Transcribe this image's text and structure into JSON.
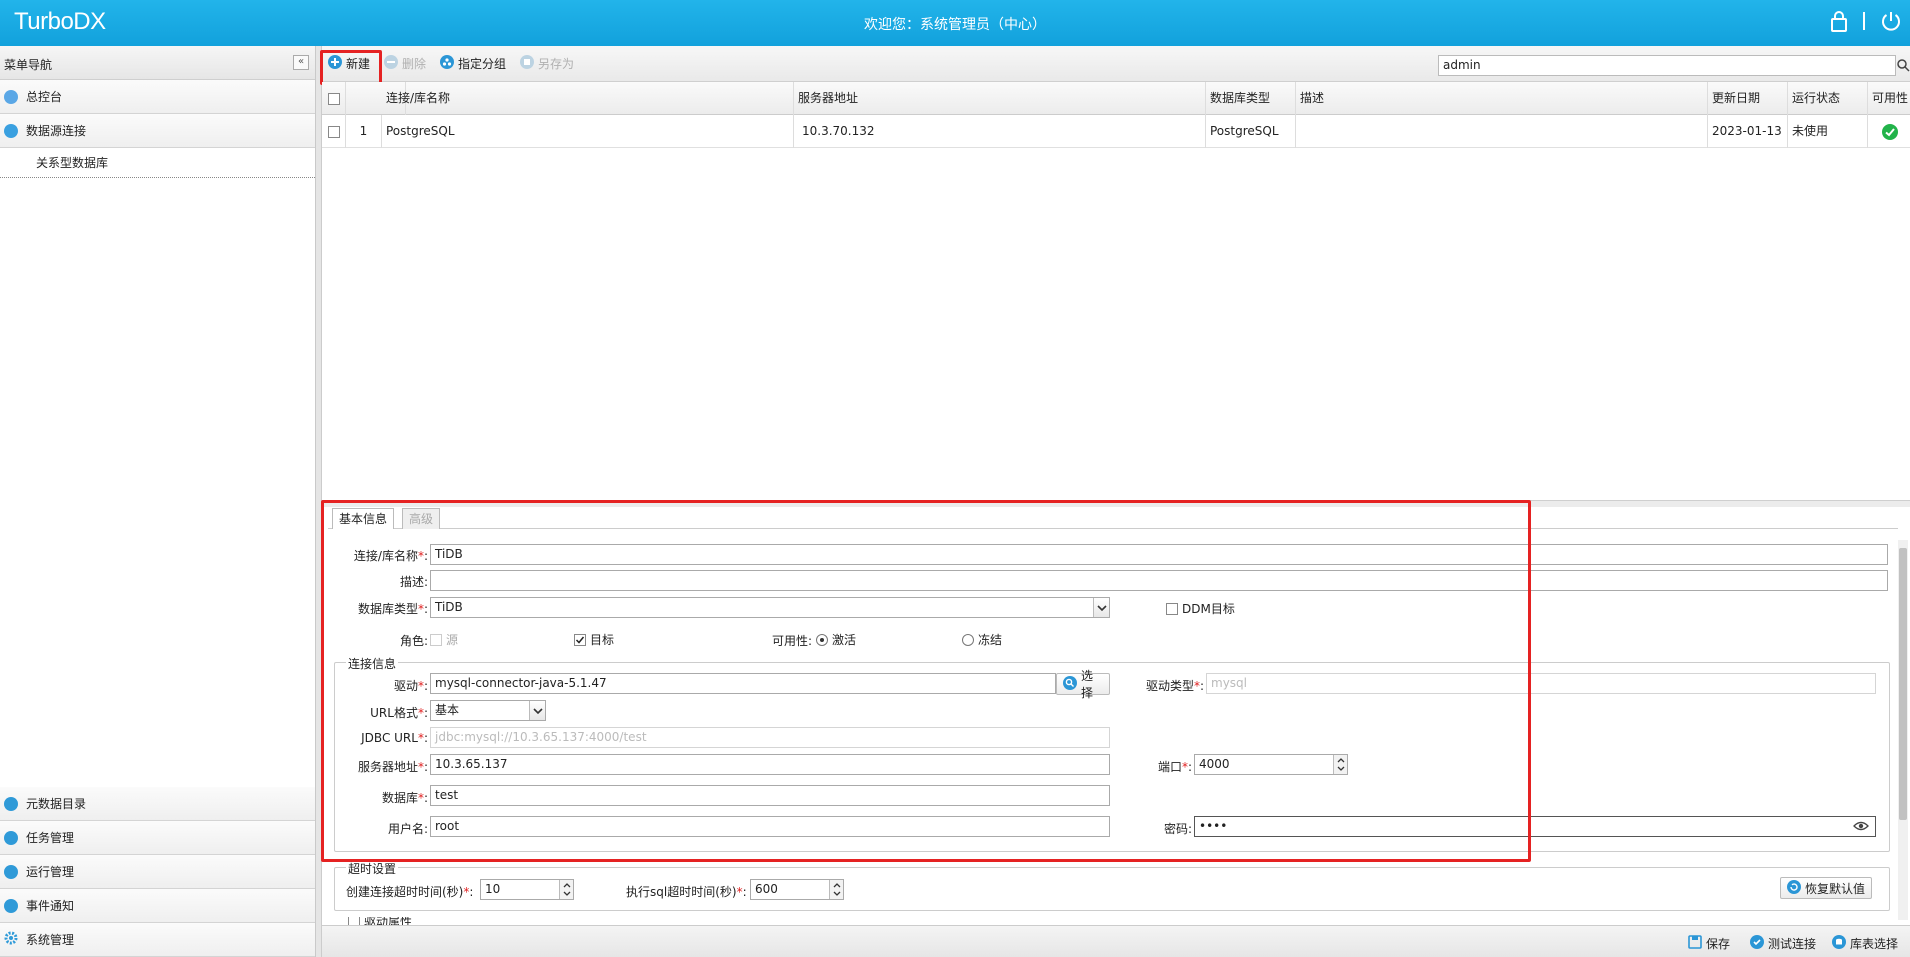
{
  "header": {
    "logo": "TurboDX",
    "welcome": "欢迎您：系统管理员（中心）"
  },
  "sidebar": {
    "title": "菜单导航",
    "items_top": [
      {
        "label": "总控台",
        "icon": "dashboard-icon"
      },
      {
        "label": "数据源连接",
        "icon": "link-icon"
      }
    ],
    "sub_item": "关系型数据库",
    "items_bottom": [
      {
        "label": "元数据目录",
        "icon": "metadata-icon"
      },
      {
        "label": "任务管理",
        "icon": "task-icon"
      },
      {
        "label": "运行管理",
        "icon": "run-icon"
      },
      {
        "label": "事件通知",
        "icon": "notification-icon"
      },
      {
        "label": "系统管理",
        "icon": "gear-icon"
      }
    ]
  },
  "toolbar": {
    "new_label": "新建",
    "delete_label": "删除",
    "assign_group_label": "指定分组",
    "save_as_label": "另存为",
    "search_value": "admin"
  },
  "grid": {
    "columns": [
      "连接/库名称",
      "服务器地址",
      "数据库类型",
      "描述",
      "更新日期",
      "运行状态",
      "可用性"
    ],
    "rows": [
      {
        "index": "1",
        "name": "PostgreSQL",
        "server": "10.3.70.132",
        "db_type": "PostgreSQL",
        "desc": "",
        "updated": "2023-01-13",
        "status": "未使用",
        "availability": "ok"
      }
    ]
  },
  "form": {
    "tabs": [
      "基本信息",
      "高级"
    ],
    "name_label": "连接/库名称",
    "name_value": "TiDB",
    "desc_label": "描述:",
    "desc_value": "",
    "dbtype_label": "数据库类型",
    "dbtype_value": "TiDB",
    "ddm_label": "DDM目标",
    "role_label": "角色:",
    "role_source": "源",
    "role_target": "目标",
    "avail_label": "可用性:",
    "avail_active": "激活",
    "avail_frozen": "冻结",
    "conn_legend": "连接信息",
    "driver_label": "驱动",
    "driver_value": "mysql-connector-java-5.1.47",
    "choose_label": "选择",
    "driver_type_label": "驱动类型",
    "driver_type_value": "mysql",
    "url_format_label": "URL格式",
    "url_format_value": "基本",
    "jdbc_label": "JDBC URL",
    "jdbc_value": "jdbc:mysql://10.3.65.137:4000/test",
    "server_label": "服务器地址",
    "server_value": "10.3.65.137",
    "port_label": "端口",
    "port_value": "4000",
    "database_label": "数据库",
    "database_value": "test",
    "user_label": "用户名:",
    "user_value": "root",
    "password_label": "密码:",
    "password_value": "••••",
    "timeout_legend": "超时设置",
    "create_timeout_label": "创建连接超时时间(秒)",
    "create_timeout_value": "10",
    "sql_timeout_label": "执行sql超时时间(秒)",
    "sql_timeout_value": "600",
    "restore_label": "恢复默认值",
    "driver_props_label": "驱动属性"
  },
  "bottom": {
    "save_label": "保存",
    "test_label": "测试连接",
    "table_select_label": "库表选择"
  },
  "colors": {
    "header_bg": "#17a8e2",
    "highlight_red": "#e52222",
    "ok_green": "#22b34a"
  }
}
